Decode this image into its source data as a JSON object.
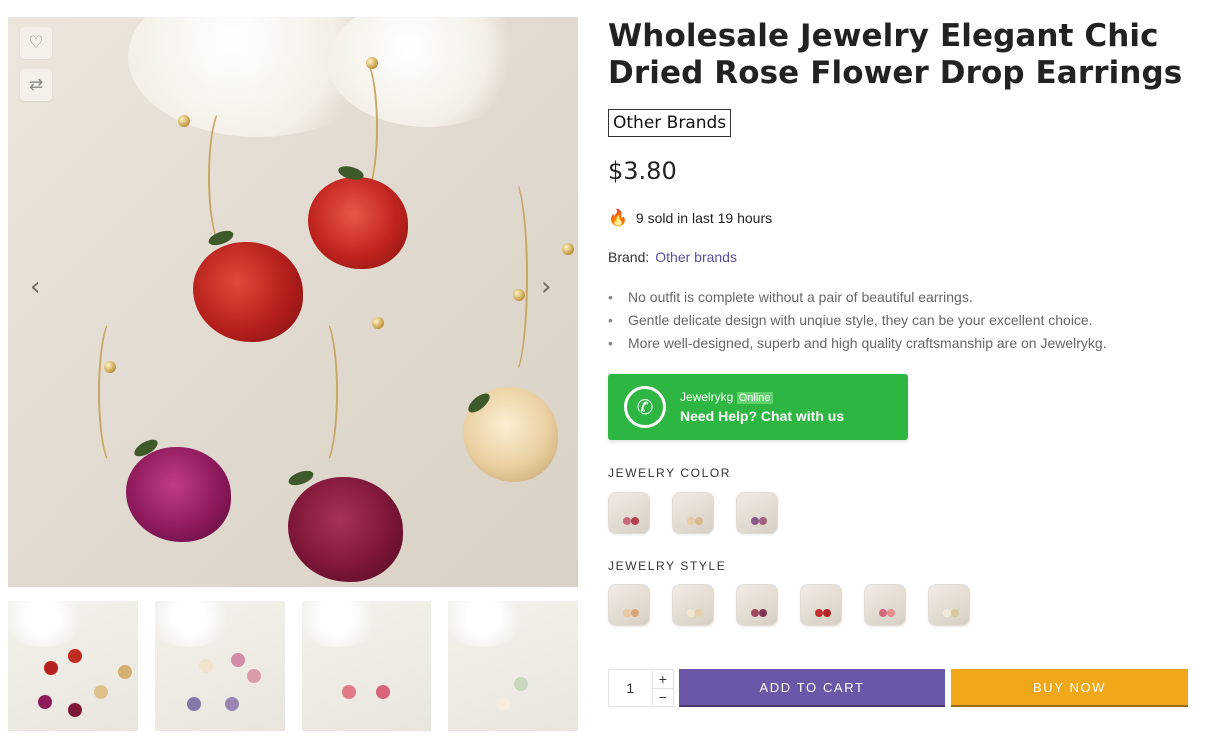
{
  "product": {
    "title": "Wholesale Jewelry Elegant Chic Dried Rose Flower Drop Earrings",
    "brand_tag": "Other Brands",
    "price": "$3.80",
    "sold_text": "9 sold in last 19 hours",
    "brand_label": "Brand:",
    "brand_link": "Other brands",
    "bullets": [
      "No outfit is complete without a pair of beautiful earrings.",
      "Gentle delicate design with unqiue style, they can be your excellent choice.",
      "More well-designed, superb and high quality craftsmanship are on Jewelrykg."
    ]
  },
  "whatsapp": {
    "name": "Jewelrykg",
    "status": "Online",
    "help": "Need Help? Chat with us"
  },
  "options": {
    "color_label": "JEWELRY COLOR",
    "style_label": "JEWELRY STYLE"
  },
  "cart": {
    "quantity": "1",
    "plus": "+",
    "minus": "−",
    "add_to_cart": "ADD TO CART",
    "buy_now": "BUY NOW"
  },
  "gallery": {
    "prev": "‹",
    "next": "›"
  },
  "colors": {
    "whatsapp": "#2db742",
    "add_to_cart": "#6a57a8",
    "buy_now": "#f0a71a",
    "brand_link": "#5a4fa0"
  }
}
